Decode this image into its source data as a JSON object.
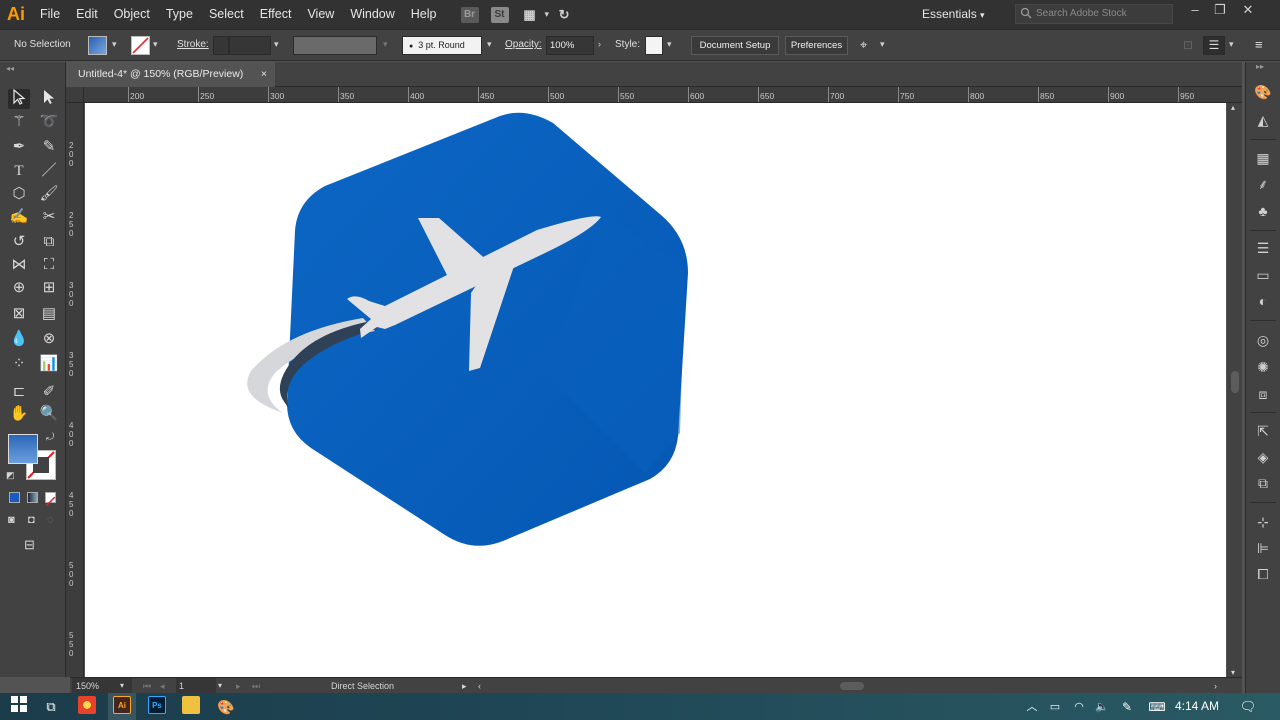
{
  "app": {
    "logo_text": "Ai",
    "menu": [
      "File",
      "Edit",
      "Object",
      "Type",
      "Select",
      "Effect",
      "View",
      "Window",
      "Help"
    ],
    "bridge_icon": "Br",
    "stock_icon": "St",
    "workspace": "Essentials",
    "search_placeholder": "Search Adobe Stock"
  },
  "control_bar": {
    "selection_status": "No Selection",
    "stroke_label": "Stroke:",
    "brush_value": "3 pt. Round",
    "opacity_label": "Opacity:",
    "opacity_value": "100%",
    "style_label": "Style:",
    "document_setup_label": "Document Setup",
    "preferences_label": "Preferences"
  },
  "document": {
    "tab_title": "Untitled-4* @ 150% (RGB/Preview)",
    "close_glyph": "×"
  },
  "rulers": {
    "horizontal": [
      "200",
      "250",
      "300",
      "350",
      "400",
      "450",
      "500",
      "550",
      "600",
      "650",
      "700",
      "750",
      "800",
      "850",
      "900",
      "950"
    ],
    "vertical": [
      "200",
      "250",
      "300",
      "350",
      "400",
      "450",
      "500",
      "550"
    ]
  },
  "status_bar": {
    "zoom": "150%",
    "artboard_number": "1",
    "current_tool": "Direct Selection"
  },
  "taskbar": {
    "time": "4:14 AM",
    "apps": [
      "chrome-icon",
      "illustrator-icon",
      "photoshop-icon",
      "file-explorer-icon",
      "paint-icon"
    ]
  },
  "colors": {
    "logo_blue": "#0a62bf",
    "logo_blue_dark": "#0757ad",
    "plane_gray": "#d9d9dc",
    "orbit_dark": "#3b4a5c",
    "fill_swatch": "#3f7fcf",
    "app_orange": "#ff9a00"
  }
}
